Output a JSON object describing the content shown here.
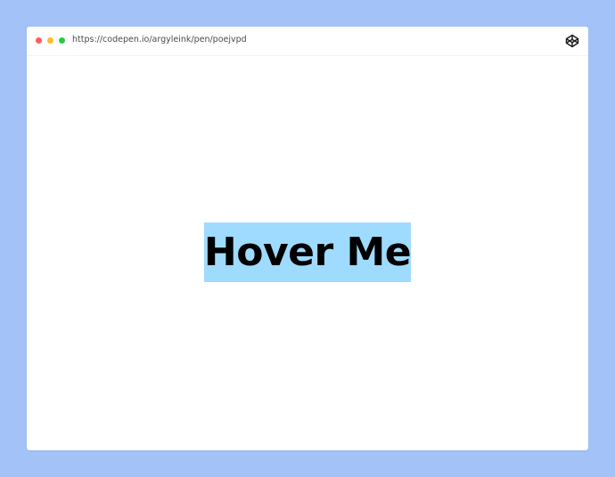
{
  "browser": {
    "url": "https://codepen.io/argyleink/pen/poejvpd",
    "controls": [
      "close",
      "minimize",
      "maximize"
    ],
    "toolbar_icon": "codepen-icon"
  },
  "demo": {
    "label": "Hover Me",
    "highlight_color": "#9fdbff"
  },
  "colors": {
    "backdrop": "#a3c2f7",
    "window": "#ffffff",
    "close": "#ff5f57",
    "minimize": "#febc2e",
    "maximize": "#28c840"
  }
}
